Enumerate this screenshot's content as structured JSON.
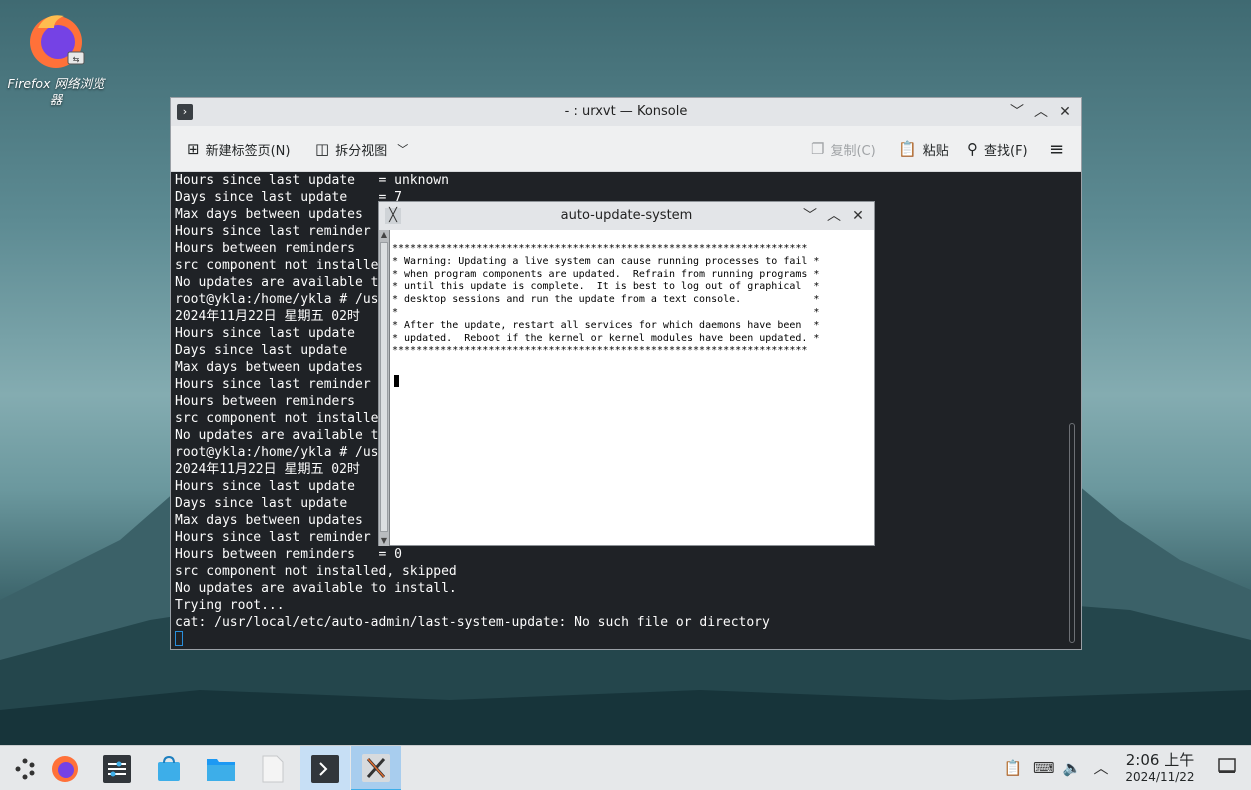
{
  "desktop": {
    "icons": [
      {
        "label": "Firefox 网络浏览器",
        "icon": "firefox-icon"
      }
    ]
  },
  "konsole": {
    "title": "- : urxvt — Konsole",
    "toolbar": {
      "new_tab": "新建标签页(N)",
      "split_view": "拆分视图",
      "copy": "复制(C)",
      "paste": "粘贴",
      "find": "查找(F)"
    },
    "terminal_lines": [
      "Hours since last update   = unknown",
      "Days since last update    = 7",
      "Max days between updates",
      "Hours since last reminder",
      "Hours between reminders",
      "src component not installe",
      "No updates are available t",
      "root@ykla:/home/ykla # /us",
      "2024年11月22日 星期五 02时",
      "Hours since last update",
      "Days since last update",
      "Max days between updates",
      "Hours since last reminder",
      "Hours between reminders",
      "src component not installe",
      "No updates are available t",
      "root@ykla:/home/ykla # /us",
      "2024年11月22日 星期五 02时",
      "Hours since last update",
      "Days since last update",
      "Max days between updates",
      "Hours since last reminder",
      "Hours between reminders   = 0",
      "src component not installed, skipped",
      "No updates are available to install.",
      "Trying root...",
      "cat: /usr/local/etc/auto-admin/last-system-update: No such file or directory"
    ]
  },
  "xterm": {
    "title": "auto-update-system",
    "lines": [
      "*********************************************************************",
      "* Warning: Updating a live system can cause running processes to fail *",
      "* when program components are updated.  Refrain from running programs *",
      "* until this update is complete.  It is best to log out of graphical  *",
      "* desktop sessions and run the update from a text console.            *",
      "*                                                                     *",
      "* After the update, restart all services for which daemons have been  *",
      "* updated.  Reboot if the kernel or kernel modules have been updated. *",
      "*********************************************************************"
    ]
  },
  "taskbar": {
    "clock_time": "2:06 上午",
    "clock_date": "2024/11/22"
  },
  "colors": {
    "terminal_bg": "#1f2226",
    "accent": "#3daee9",
    "panel_bg": "#e6e8ea"
  }
}
